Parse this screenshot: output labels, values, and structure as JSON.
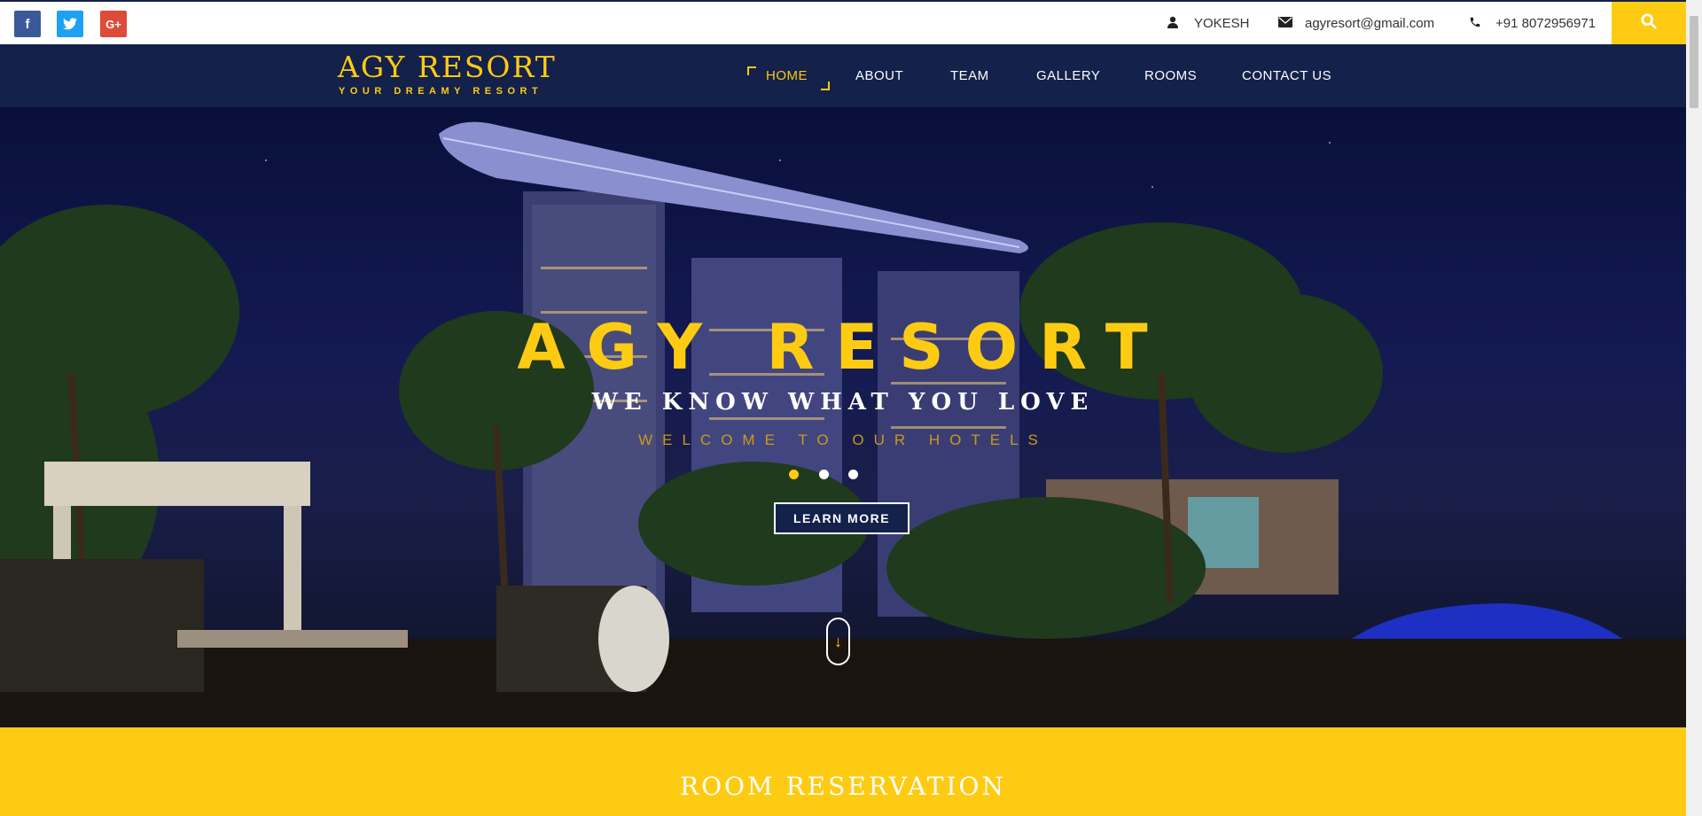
{
  "topbar": {
    "social": [
      {
        "name": "facebook",
        "glyph": "f"
      },
      {
        "name": "twitter",
        "glyph": "t"
      },
      {
        "name": "google-plus",
        "glyph": "G+"
      }
    ],
    "user": "YOKESH",
    "email": "agyresort@gmail.com",
    "phone": "+91 8072956971"
  },
  "brand": {
    "title": "AGY RESORT",
    "subtitle": "YOUR DREAMY RESORT"
  },
  "nav": {
    "items": [
      "HOME",
      "ABOUT",
      "TEAM",
      "GALLERY",
      "ROOMS",
      "CONTACT US"
    ],
    "active": "HOME"
  },
  "hero": {
    "title": "AGY RESORT",
    "subtitle": "WE KNOW WHAT YOU LOVE",
    "welcome": "WELCOME TO OUR HOTELS",
    "button": "LEARN MORE",
    "slides": 3,
    "active_slide": 1
  },
  "reservation": {
    "title": "ROOM RESERVATION"
  },
  "colors": {
    "navy": "#13214b",
    "gold": "#fecb13"
  }
}
